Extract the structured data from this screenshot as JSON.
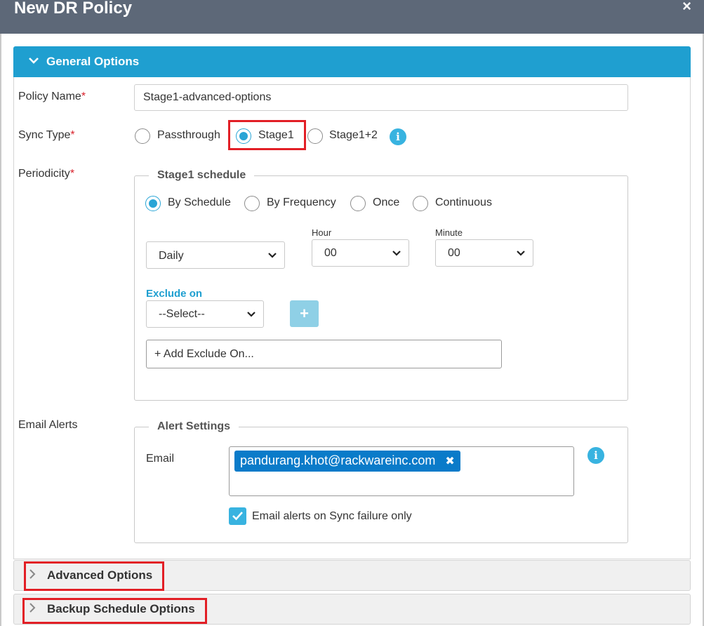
{
  "dialog": {
    "title": "New DR Policy",
    "close_glyph": "×"
  },
  "general": {
    "header_label": "General Options",
    "policy_name": {
      "label": "Policy Name",
      "required_mark": "*",
      "value": "Stage1-advanced-options"
    },
    "sync_type": {
      "label": "Sync Type",
      "required_mark": "*",
      "options": [
        "Passthrough",
        "Stage1",
        "Stage1+2"
      ],
      "selected": "Stage1"
    },
    "periodicity": {
      "label": "Periodicity",
      "required_mark": "*",
      "legend": "Stage1 schedule",
      "modes": [
        "By Schedule",
        "By Frequency",
        "Once",
        "Continuous"
      ],
      "selected_mode": "By Schedule",
      "frequency_value": "Daily",
      "hour_label": "Hour",
      "hour_value": "00",
      "minute_label": "Minute",
      "minute_value": "00",
      "exclude_label": "Exclude on",
      "exclude_select": "--Select--",
      "add_button": "+",
      "exclude_placeholder": "+ Add Exclude On..."
    },
    "email_alerts": {
      "label": "Email Alerts",
      "legend": "Alert Settings",
      "email_label": "Email",
      "emails": [
        "pandurang.khot@rackwareinc.com"
      ],
      "chip_remove": "✖",
      "failure_only_label": "Email alerts on Sync failure only",
      "failure_only_checked": true
    }
  },
  "sections": {
    "advanced_label": "Advanced Options",
    "backup_label": "Backup Schedule Options"
  },
  "icons": [
    "close-icon",
    "chevron-down-icon",
    "chevron-right-icon",
    "info-icon",
    "caret-down-icon",
    "check-icon"
  ],
  "colors": {
    "header_bar": "#5d6878",
    "accent": "#1f9fd0",
    "chip": "#0a7bc9",
    "highlight": "#e21f26"
  }
}
